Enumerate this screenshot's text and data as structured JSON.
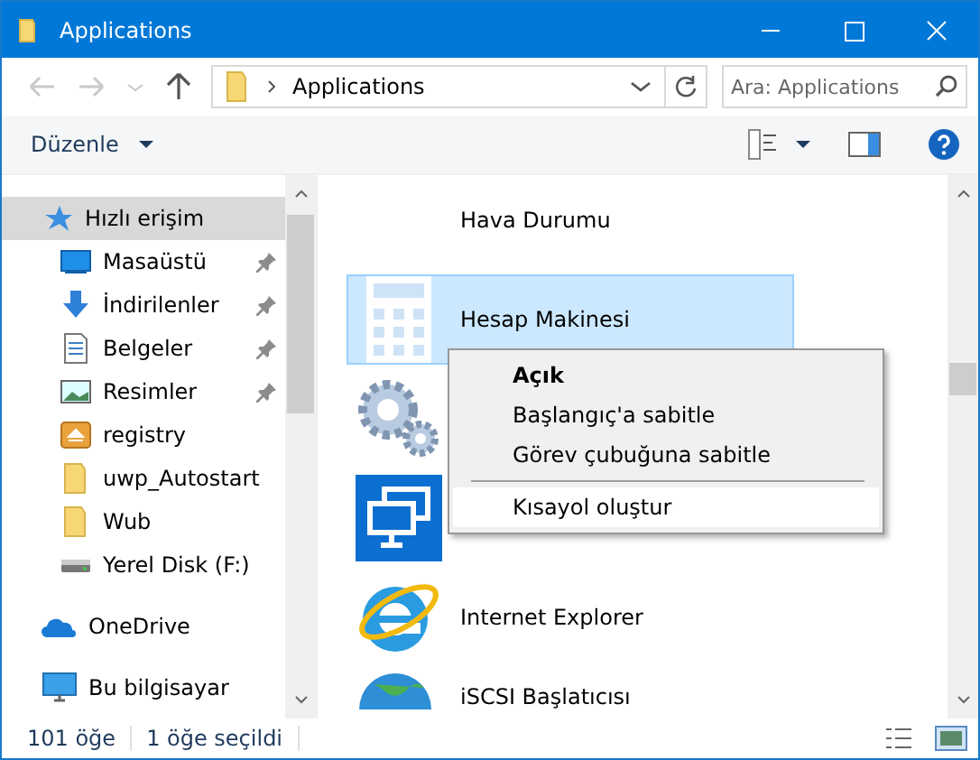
{
  "window": {
    "title": "Applications"
  },
  "address": {
    "path": "Applications",
    "search_placeholder": "Ara: Applications"
  },
  "toolbar": {
    "organize": "Düzenle"
  },
  "sidebar": {
    "items": [
      {
        "label": "Hızlı erişim",
        "kind": "star",
        "selected": true,
        "pinned": false,
        "child": false
      },
      {
        "label": "Masaüstü",
        "kind": "desktop",
        "selected": false,
        "pinned": true,
        "child": true
      },
      {
        "label": "İndirilenler",
        "kind": "download",
        "selected": false,
        "pinned": true,
        "child": true
      },
      {
        "label": "Belgeler",
        "kind": "document",
        "selected": false,
        "pinned": true,
        "child": true
      },
      {
        "label": "Resimler",
        "kind": "picture",
        "selected": false,
        "pinned": true,
        "child": true
      },
      {
        "label": "registry",
        "kind": "archive",
        "selected": false,
        "pinned": false,
        "child": true
      },
      {
        "label": "uwp_Autostart",
        "kind": "folder",
        "selected": false,
        "pinned": false,
        "child": true
      },
      {
        "label": "Wub",
        "kind": "folder",
        "selected": false,
        "pinned": false,
        "child": true
      },
      {
        "label": "Yerel Disk (F:)",
        "kind": "drive",
        "selected": false,
        "pinned": false,
        "child": true
      },
      {
        "label": "OneDrive",
        "kind": "cloud",
        "selected": false,
        "pinned": false,
        "child": false
      },
      {
        "label": "Bu bilgisayar",
        "kind": "computer",
        "selected": false,
        "pinned": false,
        "child": false
      }
    ]
  },
  "files": [
    {
      "label": "Hava Durumu",
      "kind": "none",
      "selected": false
    },
    {
      "label": "Hesap Makinesi",
      "kind": "calculator",
      "selected": true
    },
    {
      "kind": "gears",
      "selected": false
    },
    {
      "kind": "remote",
      "selected": false
    },
    {
      "label": "Internet Explorer",
      "kind": "browser",
      "selected": false
    },
    {
      "label": "iSCSI Başlatıcısı",
      "kind": "globe",
      "selected": false
    }
  ],
  "context_menu": [
    {
      "label": "Açık",
      "kind": "item",
      "bold": true,
      "highlighted": false
    },
    {
      "label": "Başlangıç'a sabitle",
      "kind": "item",
      "bold": false,
      "highlighted": false
    },
    {
      "label": "Görev çubuğuna sabitle",
      "kind": "item",
      "bold": false,
      "highlighted": false
    },
    {
      "kind": "separator"
    },
    {
      "label": "Kısayol oluştur",
      "kind": "item",
      "bold": false,
      "highlighted": true
    }
  ],
  "status_bar": {
    "count": "101 öğe",
    "selection": "1 öğe seçildi"
  }
}
